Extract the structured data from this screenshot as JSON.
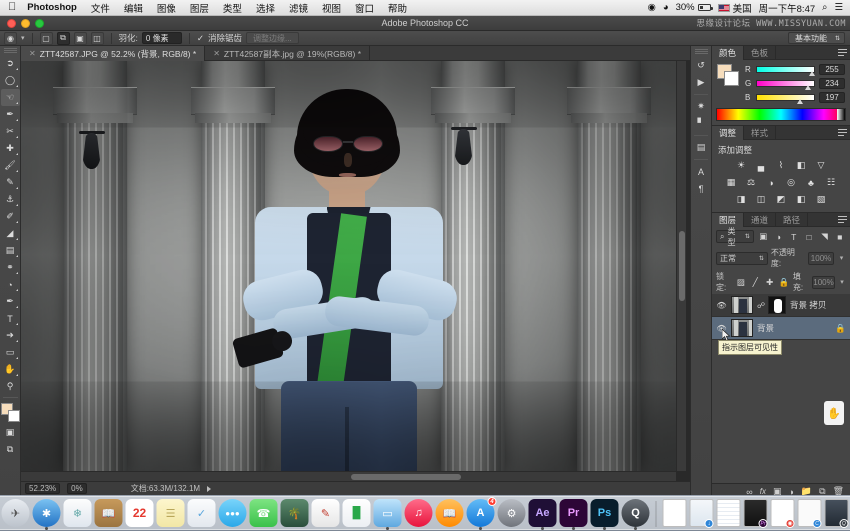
{
  "menubar": {
    "apple_icon": "apple-icon",
    "app_name": "Photoshop",
    "items": [
      "文件",
      "编辑",
      "图像",
      "图层",
      "类型",
      "选择",
      "滤镜",
      "视图",
      "窗口",
      "帮助"
    ],
    "right": {
      "record_icon": "record-icon",
      "wifi_icon": "wifi-icon",
      "battery_percent": "30%",
      "input_source_flag": "us-flag-icon",
      "input_source": "美国",
      "clock": "周一下午8:47",
      "search_icon": "search-icon",
      "notification_icon": "notification-center-icon"
    }
  },
  "window": {
    "title": "Adobe Photoshop CC",
    "watermark": "思缘设计论坛  WWW.MISSYUAN.COM",
    "traffic_lights": [
      "close",
      "minimize",
      "zoom"
    ]
  },
  "options_bar": {
    "tool_icon": "lasso-tool-icon",
    "tool_preset_caret": "chevron-down-icon",
    "selection_modes": [
      "new-selection",
      "add-to-selection",
      "subtract-from-selection",
      "intersect-selection"
    ],
    "feather_label": "羽化:",
    "feather_value": "0 像素",
    "antialias_label": "消除锯齿",
    "antialias_checked": true,
    "refine_edge_label": "调整边缘...",
    "workspace_label": "基本功能"
  },
  "toolbar": {
    "tools": [
      {
        "name": "move-tool",
        "glyph": "➤"
      },
      {
        "name": "elliptical-marquee-tool",
        "glyph": "◯"
      },
      {
        "name": "lasso-tool",
        "glyph": "☄",
        "selected": true
      },
      {
        "name": "quick-selection-tool",
        "glyph": "✒"
      },
      {
        "name": "crop-tool",
        "glyph": "✀"
      },
      {
        "name": "eyedropper-tool",
        "glyph": "⚗"
      },
      {
        "name": "spot-healing-brush-tool",
        "glyph": "☂"
      },
      {
        "name": "brush-tool",
        "glyph": "✎"
      },
      {
        "name": "clone-stamp-tool",
        "glyph": "⚓"
      },
      {
        "name": "history-brush-tool",
        "glyph": "✐"
      },
      {
        "name": "eraser-tool",
        "glyph": "◢"
      },
      {
        "name": "gradient-tool",
        "glyph": "▤"
      },
      {
        "name": "blur-tool",
        "glyph": "◌"
      },
      {
        "name": "dodge-tool",
        "glyph": "◔"
      },
      {
        "name": "pen-tool",
        "glyph": "✒"
      },
      {
        "name": "horizontal-type-tool",
        "glyph": "T"
      },
      {
        "name": "path-selection-tool",
        "glyph": "➤"
      },
      {
        "name": "rectangle-tool",
        "glyph": "▭"
      },
      {
        "name": "hand-tool",
        "glyph": "✋"
      },
      {
        "name": "zoom-tool",
        "glyph": "⚲"
      }
    ],
    "foreground_color": "#f6ddbc",
    "background_color": "#ffffff",
    "quick_mask_icon": "quick-mask-icon",
    "screen_mode_icon": "screen-mode-icon"
  },
  "document_tabs": [
    {
      "label": "ZTT42587.JPG @ 52.2% (背景, RGB/8) *",
      "active": true
    },
    {
      "label": "ZTT42587副本.jpg @ 19%(RGB/8) *",
      "active": false
    }
  ],
  "status_bar": {
    "zoom": "52.23%",
    "zoom_badge": "0%",
    "doc_info": "文档:63.3M/132.1M",
    "expand_icon": "play-triangle-icon"
  },
  "rail": {
    "icons": [
      {
        "name": "history-panel-icon",
        "glyph": "↺"
      },
      {
        "name": "actions-panel-icon",
        "glyph": "▶"
      },
      {
        "name": "brush-panel-icon",
        "glyph": "✹"
      },
      {
        "name": "histogram-panel-icon",
        "glyph": "█"
      },
      {
        "name": "properties-panel-icon",
        "glyph": "▤"
      },
      {
        "name": "character-panel-icon",
        "glyph": "A"
      },
      {
        "name": "paragraph-panel-icon",
        "glyph": "¶"
      }
    ]
  },
  "color_panel": {
    "tabs": [
      {
        "label": "颜色",
        "active": true
      },
      {
        "label": "色板",
        "active": false
      }
    ],
    "menu_icon": "panel-menu-icon",
    "channels": [
      {
        "label": "R",
        "value": "255",
        "pos": 96
      },
      {
        "label": "G",
        "value": "234",
        "pos": 88
      },
      {
        "label": "B",
        "value": "197",
        "pos": 74
      }
    ],
    "foreground_color": "#f6ddbc",
    "background_color": "#ffffff"
  },
  "adjustments_panel": {
    "tabs": [
      {
        "label": "调整",
        "active": true
      },
      {
        "label": "样式",
        "active": false
      }
    ],
    "menu_icon": "panel-menu-icon",
    "heading": "添加调整",
    "rows": [
      [
        {
          "name": "brightness-contrast-adjustment",
          "glyph": "☀"
        },
        {
          "name": "levels-adjustment",
          "glyph": "ᴘ"
        },
        {
          "name": "curves-adjustment",
          "glyph": "⌇"
        },
        {
          "name": "exposure-adjustment",
          "glyph": "◧"
        },
        {
          "name": "vibrance-adjustment",
          "glyph": "▽"
        }
      ],
      [
        {
          "name": "hue-saturation-adjustment",
          "glyph": "▦"
        },
        {
          "name": "color-balance-adjustment",
          "glyph": "⚖"
        },
        {
          "name": "black-white-adjustment",
          "glyph": "◑"
        },
        {
          "name": "photo-filter-adjustment",
          "glyph": "◎"
        },
        {
          "name": "channel-mixer-adjustment",
          "glyph": "♣"
        },
        {
          "name": "color-lookup-adjustment",
          "glyph": "⌗"
        }
      ],
      [
        {
          "name": "invert-adjustment",
          "glyph": "◨"
        },
        {
          "name": "posterize-adjustment",
          "glyph": "◫"
        },
        {
          "name": "threshold-adjustment",
          "glyph": "◩"
        },
        {
          "name": "gradient-map-adjustment",
          "glyph": "◧"
        },
        {
          "name": "selective-color-adjustment",
          "glyph": "▧"
        }
      ]
    ]
  },
  "layers_panel": {
    "tabs": [
      {
        "label": "图层",
        "active": true
      },
      {
        "label": "通道",
        "active": false
      },
      {
        "label": "路径",
        "active": false
      }
    ],
    "menu_icon": "panel-menu-icon",
    "filter": {
      "search_icon": "search-icon",
      "kind_label": "类型",
      "caret": "chevron-down-icon",
      "filter_icons": [
        {
          "name": "filter-pixel-icon",
          "glyph": "▣"
        },
        {
          "name": "filter-adjustment-icon",
          "glyph": "◑"
        },
        {
          "name": "filter-type-icon",
          "glyph": "T"
        },
        {
          "name": "filter-shape-icon",
          "glyph": "□"
        },
        {
          "name": "filter-smart-object-icon",
          "glyph": "◥"
        }
      ],
      "toggle_icon": "filter-toggle-icon"
    },
    "blend_mode": "正常",
    "opacity_label": "不透明度:",
    "opacity_value": "100%",
    "lock_label": "锁定:",
    "lock_icons": [
      {
        "name": "lock-transparent-pixels-icon",
        "glyph": "▨"
      },
      {
        "name": "lock-image-pixels-icon",
        "glyph": "╱"
      },
      {
        "name": "lock-position-icon",
        "glyph": "✚"
      },
      {
        "name": "lock-all-icon",
        "glyph": "⚿"
      }
    ],
    "fill_label": "填充:",
    "fill_value": "100%",
    "layers": [
      {
        "name": "背景 拷贝",
        "visible": true,
        "has_mask": true,
        "locked": false,
        "selected": false
      },
      {
        "name": "背景",
        "visible": true,
        "has_mask": false,
        "locked": true,
        "selected": true
      }
    ],
    "tooltip": "指示图层可见性",
    "bottom_buttons": [
      {
        "name": "link-layers-button",
        "glyph": "∞"
      },
      {
        "name": "layer-style-button",
        "glyph": "fx"
      },
      {
        "name": "add-layer-mask-button",
        "glyph": "▣"
      },
      {
        "name": "new-adjustment-layer-button",
        "glyph": "◑"
      },
      {
        "name": "new-group-button",
        "glyph": "▱"
      },
      {
        "name": "new-layer-button",
        "glyph": "⧉"
      },
      {
        "name": "delete-layer-button",
        "glyph": "⌧"
      }
    ]
  },
  "dock": {
    "items": [
      {
        "name": "finder",
        "color": "#3b9ae1",
        "glyph": "☺",
        "running": true
      },
      {
        "name": "launchpad",
        "color": "#c8cdd4",
        "glyph": "▶",
        "running": false
      },
      {
        "name": "safari",
        "color": "#2f8ee0",
        "glyph": "⦿",
        "running": true
      },
      {
        "name": "photos",
        "color": "#eef2f7",
        "glyph": "❀",
        "running": false
      },
      {
        "name": "contacts",
        "color": "#c89b5a",
        "glyph": "☷",
        "running": false
      },
      {
        "name": "calendar",
        "color": "#ffffff",
        "glyph": "22",
        "running": false
      },
      {
        "name": "notes",
        "color": "#fdf3c8",
        "glyph": "▤",
        "running": false
      },
      {
        "name": "reminders",
        "color": "#f4f6f8",
        "glyph": "✓",
        "running": false
      },
      {
        "name": "messages",
        "color": "#4fc3f7",
        "glyph": "●●●",
        "running": true
      },
      {
        "name": "facetime",
        "color": "#5ed663",
        "glyph": "✆",
        "running": false
      },
      {
        "name": "photo-booth",
        "color": "#2f6f4f",
        "glyph": "✿",
        "running": false
      },
      {
        "name": "text-edit",
        "color": "#f2f2f2",
        "glyph": "✎",
        "running": false
      },
      {
        "name": "numbers",
        "color": "#f7f7f7",
        "glyph": "█",
        "running": false
      },
      {
        "name": "keynote",
        "color": "#3aa5e0",
        "glyph": "▭",
        "running": true
      },
      {
        "name": "itunes",
        "color": "#fb3a5c",
        "glyph": "♫",
        "running": false
      },
      {
        "name": "ibooks",
        "color": "#ff9d27",
        "glyph": "◖",
        "running": false
      },
      {
        "name": "app-store",
        "color": "#2e9bf0",
        "glyph": "A",
        "running": true,
        "badge": "4"
      },
      {
        "name": "system-preferences",
        "color": "#8e9095",
        "glyph": "⚙",
        "running": false
      },
      {
        "name": "after-effects",
        "color": "#2a1a4a",
        "glyph": "Ae",
        "running": true
      },
      {
        "name": "premiere-pro",
        "color": "#3b1048",
        "glyph": "Pr",
        "running": true
      },
      {
        "name": "photoshop",
        "color": "#0d2b3e",
        "glyph": "Ps",
        "running": true
      },
      {
        "name": "quicktime",
        "color": "#3b4147",
        "glyph": "Q",
        "running": true
      }
    ],
    "documents": [
      {
        "name": "blank-document",
        "badge": ""
      },
      {
        "name": "recent-document-1",
        "badge": "↓"
      },
      {
        "name": "recent-spreadsheet",
        "badge": ""
      },
      {
        "name": "premiere-project",
        "badge": "Pr"
      },
      {
        "name": "pdf-document",
        "badge": "◉"
      },
      {
        "name": "white-document",
        "badge": "C"
      },
      {
        "name": "dark-document",
        "badge": "Q"
      }
    ],
    "trash": {
      "name": "trash",
      "glyph": "Ὕ1"
    }
  }
}
